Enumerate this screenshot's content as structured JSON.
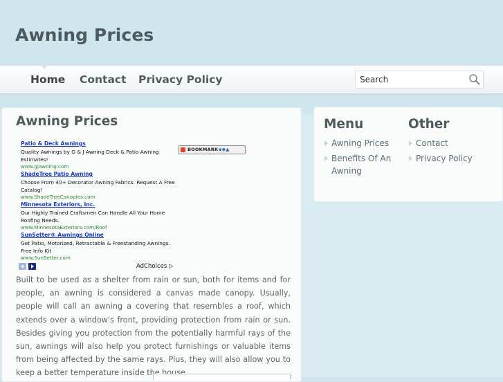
{
  "site": {
    "title": "Awning Prices"
  },
  "nav": {
    "home": "Home",
    "contact": "Contact",
    "privacy": "Privacy Policy"
  },
  "search": {
    "placeholder": "Search"
  },
  "main": {
    "title": "Awning Prices",
    "ads": [
      {
        "title": "Patio & Deck Awnings",
        "desc": "Quality Awnings by G & J Awning Deck & Patio Awning Estimates!",
        "url": "www.gjawning.com"
      },
      {
        "title": "ShadeTree Patio Awning",
        "desc": "Choose From 40+ Decorator Awning Fabrics. Request A Free Catalog!",
        "url": "www.ShadeTreeCanopies.com"
      },
      {
        "title": "Minnesota Exteriors, Inc.",
        "desc": "Our Highly Trained Craftsmen Can Handle All Your Home Roofing Needs.",
        "url": "www.MinnesotaExteriors.com/Roof"
      },
      {
        "title": "SunSetter® Awnings Online",
        "desc": "Get Patio, Motorized, Retractable & Freestanding Awnings. Free Info Kit",
        "url": "www.SunSetter.com"
      }
    ],
    "adchoices": "AdChoices",
    "bookmark_label": "BOOKMARK",
    "paragraph": "Built to be used as a shelter from rain or sun, both for items and for people, an awning is considered a canvas made canopy. Usually, people will call an awning a covering that resembles a roof, which extends over a window's front, providing protection from rain or sun. Besides giving you protection from the potentially harmful rays of the sun, awnings will also help you protect furnishings or valuable items from being affected by the same rays. Plus, they will also allow you to keep a better temperature inside the house."
  },
  "sidebar": {
    "menu": {
      "heading": "Menu",
      "items": [
        "Awning Prices",
        "Benefits Of An",
        "Awning"
      ]
    },
    "other": {
      "heading": "Other",
      "items": [
        "Contact",
        "Privacy Policy"
      ]
    }
  },
  "colors": {
    "background": "#cfe6ee",
    "link": "#1a3bbf",
    "ad_url": "#2c8a2c",
    "text": "#5a6468"
  },
  "icons": {
    "search": "search-icon",
    "bookmark": "bookmark-icon",
    "bullet": "bullet-icon"
  }
}
